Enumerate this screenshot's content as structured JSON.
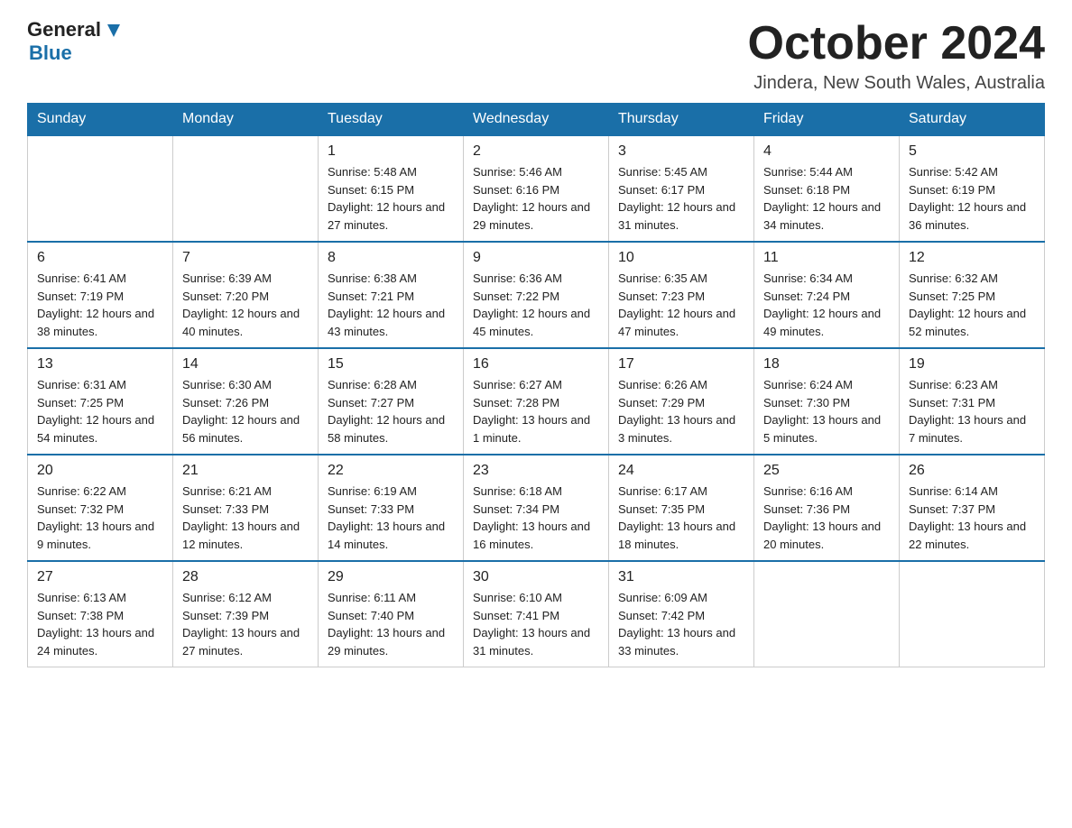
{
  "header": {
    "logo": {
      "general": "General",
      "blue": "Blue"
    },
    "title": "October 2024",
    "location": "Jindera, New South Wales, Australia"
  },
  "weekdays": [
    "Sunday",
    "Monday",
    "Tuesday",
    "Wednesday",
    "Thursday",
    "Friday",
    "Saturday"
  ],
  "weeks": [
    [
      {
        "day": "",
        "sunrise": "",
        "sunset": "",
        "daylight": ""
      },
      {
        "day": "",
        "sunrise": "",
        "sunset": "",
        "daylight": ""
      },
      {
        "day": "1",
        "sunrise": "Sunrise: 5:48 AM",
        "sunset": "Sunset: 6:15 PM",
        "daylight": "Daylight: 12 hours and 27 minutes."
      },
      {
        "day": "2",
        "sunrise": "Sunrise: 5:46 AM",
        "sunset": "Sunset: 6:16 PM",
        "daylight": "Daylight: 12 hours and 29 minutes."
      },
      {
        "day": "3",
        "sunrise": "Sunrise: 5:45 AM",
        "sunset": "Sunset: 6:17 PM",
        "daylight": "Daylight: 12 hours and 31 minutes."
      },
      {
        "day": "4",
        "sunrise": "Sunrise: 5:44 AM",
        "sunset": "Sunset: 6:18 PM",
        "daylight": "Daylight: 12 hours and 34 minutes."
      },
      {
        "day": "5",
        "sunrise": "Sunrise: 5:42 AM",
        "sunset": "Sunset: 6:19 PM",
        "daylight": "Daylight: 12 hours and 36 minutes."
      }
    ],
    [
      {
        "day": "6",
        "sunrise": "Sunrise: 6:41 AM",
        "sunset": "Sunset: 7:19 PM",
        "daylight": "Daylight: 12 hours and 38 minutes."
      },
      {
        "day": "7",
        "sunrise": "Sunrise: 6:39 AM",
        "sunset": "Sunset: 7:20 PM",
        "daylight": "Daylight: 12 hours and 40 minutes."
      },
      {
        "day": "8",
        "sunrise": "Sunrise: 6:38 AM",
        "sunset": "Sunset: 7:21 PM",
        "daylight": "Daylight: 12 hours and 43 minutes."
      },
      {
        "day": "9",
        "sunrise": "Sunrise: 6:36 AM",
        "sunset": "Sunset: 7:22 PM",
        "daylight": "Daylight: 12 hours and 45 minutes."
      },
      {
        "day": "10",
        "sunrise": "Sunrise: 6:35 AM",
        "sunset": "Sunset: 7:23 PM",
        "daylight": "Daylight: 12 hours and 47 minutes."
      },
      {
        "day": "11",
        "sunrise": "Sunrise: 6:34 AM",
        "sunset": "Sunset: 7:24 PM",
        "daylight": "Daylight: 12 hours and 49 minutes."
      },
      {
        "day": "12",
        "sunrise": "Sunrise: 6:32 AM",
        "sunset": "Sunset: 7:25 PM",
        "daylight": "Daylight: 12 hours and 52 minutes."
      }
    ],
    [
      {
        "day": "13",
        "sunrise": "Sunrise: 6:31 AM",
        "sunset": "Sunset: 7:25 PM",
        "daylight": "Daylight: 12 hours and 54 minutes."
      },
      {
        "day": "14",
        "sunrise": "Sunrise: 6:30 AM",
        "sunset": "Sunset: 7:26 PM",
        "daylight": "Daylight: 12 hours and 56 minutes."
      },
      {
        "day": "15",
        "sunrise": "Sunrise: 6:28 AM",
        "sunset": "Sunset: 7:27 PM",
        "daylight": "Daylight: 12 hours and 58 minutes."
      },
      {
        "day": "16",
        "sunrise": "Sunrise: 6:27 AM",
        "sunset": "Sunset: 7:28 PM",
        "daylight": "Daylight: 13 hours and 1 minute."
      },
      {
        "day": "17",
        "sunrise": "Sunrise: 6:26 AM",
        "sunset": "Sunset: 7:29 PM",
        "daylight": "Daylight: 13 hours and 3 minutes."
      },
      {
        "day": "18",
        "sunrise": "Sunrise: 6:24 AM",
        "sunset": "Sunset: 7:30 PM",
        "daylight": "Daylight: 13 hours and 5 minutes."
      },
      {
        "day": "19",
        "sunrise": "Sunrise: 6:23 AM",
        "sunset": "Sunset: 7:31 PM",
        "daylight": "Daylight: 13 hours and 7 minutes."
      }
    ],
    [
      {
        "day": "20",
        "sunrise": "Sunrise: 6:22 AM",
        "sunset": "Sunset: 7:32 PM",
        "daylight": "Daylight: 13 hours and 9 minutes."
      },
      {
        "day": "21",
        "sunrise": "Sunrise: 6:21 AM",
        "sunset": "Sunset: 7:33 PM",
        "daylight": "Daylight: 13 hours and 12 minutes."
      },
      {
        "day": "22",
        "sunrise": "Sunrise: 6:19 AM",
        "sunset": "Sunset: 7:33 PM",
        "daylight": "Daylight: 13 hours and 14 minutes."
      },
      {
        "day": "23",
        "sunrise": "Sunrise: 6:18 AM",
        "sunset": "Sunset: 7:34 PM",
        "daylight": "Daylight: 13 hours and 16 minutes."
      },
      {
        "day": "24",
        "sunrise": "Sunrise: 6:17 AM",
        "sunset": "Sunset: 7:35 PM",
        "daylight": "Daylight: 13 hours and 18 minutes."
      },
      {
        "day": "25",
        "sunrise": "Sunrise: 6:16 AM",
        "sunset": "Sunset: 7:36 PM",
        "daylight": "Daylight: 13 hours and 20 minutes."
      },
      {
        "day": "26",
        "sunrise": "Sunrise: 6:14 AM",
        "sunset": "Sunset: 7:37 PM",
        "daylight": "Daylight: 13 hours and 22 minutes."
      }
    ],
    [
      {
        "day": "27",
        "sunrise": "Sunrise: 6:13 AM",
        "sunset": "Sunset: 7:38 PM",
        "daylight": "Daylight: 13 hours and 24 minutes."
      },
      {
        "day": "28",
        "sunrise": "Sunrise: 6:12 AM",
        "sunset": "Sunset: 7:39 PM",
        "daylight": "Daylight: 13 hours and 27 minutes."
      },
      {
        "day": "29",
        "sunrise": "Sunrise: 6:11 AM",
        "sunset": "Sunset: 7:40 PM",
        "daylight": "Daylight: 13 hours and 29 minutes."
      },
      {
        "day": "30",
        "sunrise": "Sunrise: 6:10 AM",
        "sunset": "Sunset: 7:41 PM",
        "daylight": "Daylight: 13 hours and 31 minutes."
      },
      {
        "day": "31",
        "sunrise": "Sunrise: 6:09 AM",
        "sunset": "Sunset: 7:42 PM",
        "daylight": "Daylight: 13 hours and 33 minutes."
      },
      {
        "day": "",
        "sunrise": "",
        "sunset": "",
        "daylight": ""
      },
      {
        "day": "",
        "sunrise": "",
        "sunset": "",
        "daylight": ""
      }
    ]
  ]
}
